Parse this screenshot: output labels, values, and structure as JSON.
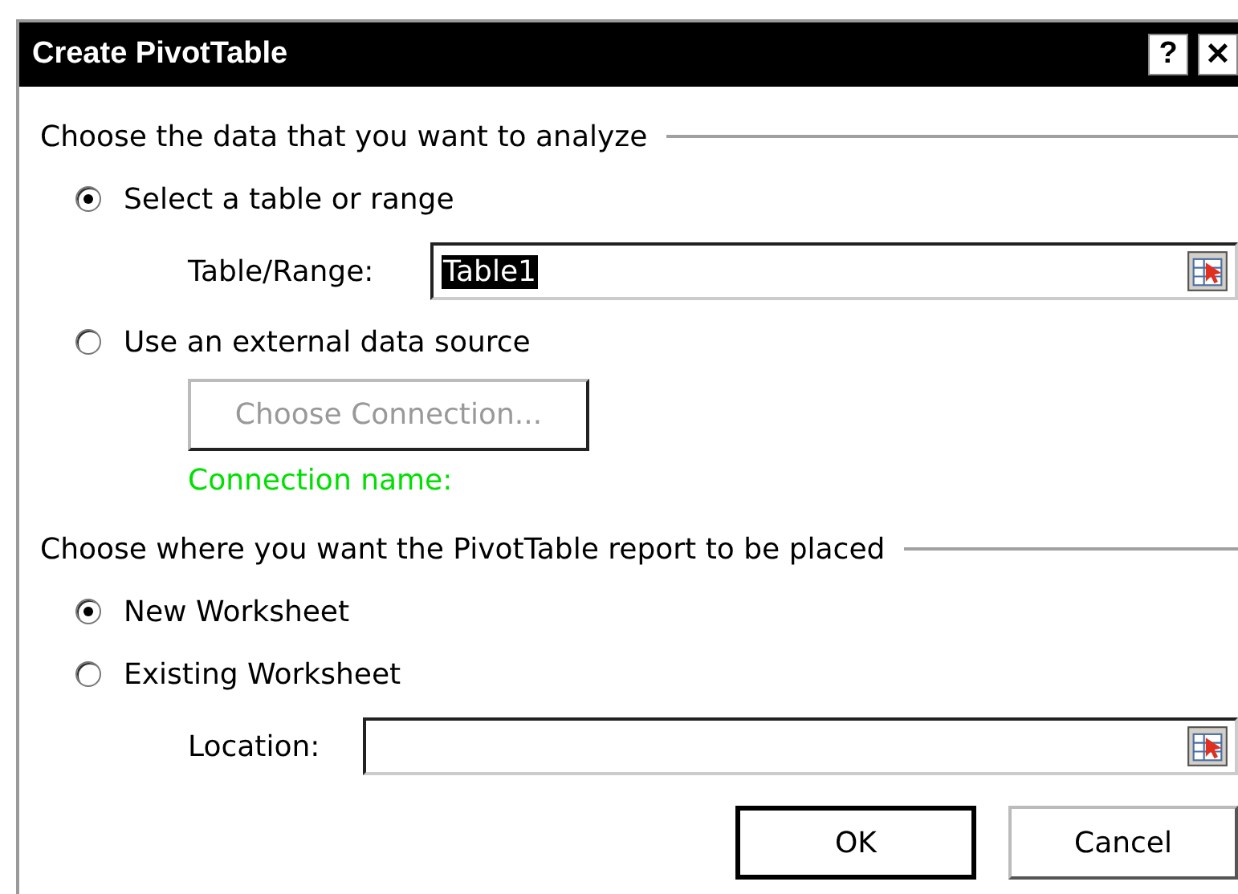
{
  "window": {
    "title": "Create PivotTable",
    "title_buttons": [
      "?",
      "✕"
    ]
  },
  "sections": [
    {
      "heading": "Choose the data that you want to analyze",
      "items": [
        {
          "kind": "radio",
          "label": "Select a table or range",
          "selected": true
        },
        {
          "kind": "field",
          "label": "Table/Range:",
          "value": "Table1",
          "value_selected": true
        },
        {
          "kind": "radio",
          "label": "Use an external data source",
          "selected": false
        },
        {
          "kind": "button",
          "label": "Choose Connection...",
          "disabled": true
        },
        {
          "kind": "note",
          "label": "Connection name:",
          "color": "#00e000"
        }
      ]
    },
    {
      "heading": "Choose where you want the PivotTable report to be placed",
      "items": [
        {
          "kind": "radio",
          "label": "New Worksheet",
          "selected": true
        },
        {
          "kind": "radio",
          "label": "Existing Worksheet",
          "selected": false
        },
        {
          "kind": "field",
          "label": "Location:",
          "value": ""
        }
      ]
    }
  ],
  "buttons": [
    {
      "label": "OK",
      "default": true
    },
    {
      "label": "Cancel",
      "default": false
    }
  ]
}
